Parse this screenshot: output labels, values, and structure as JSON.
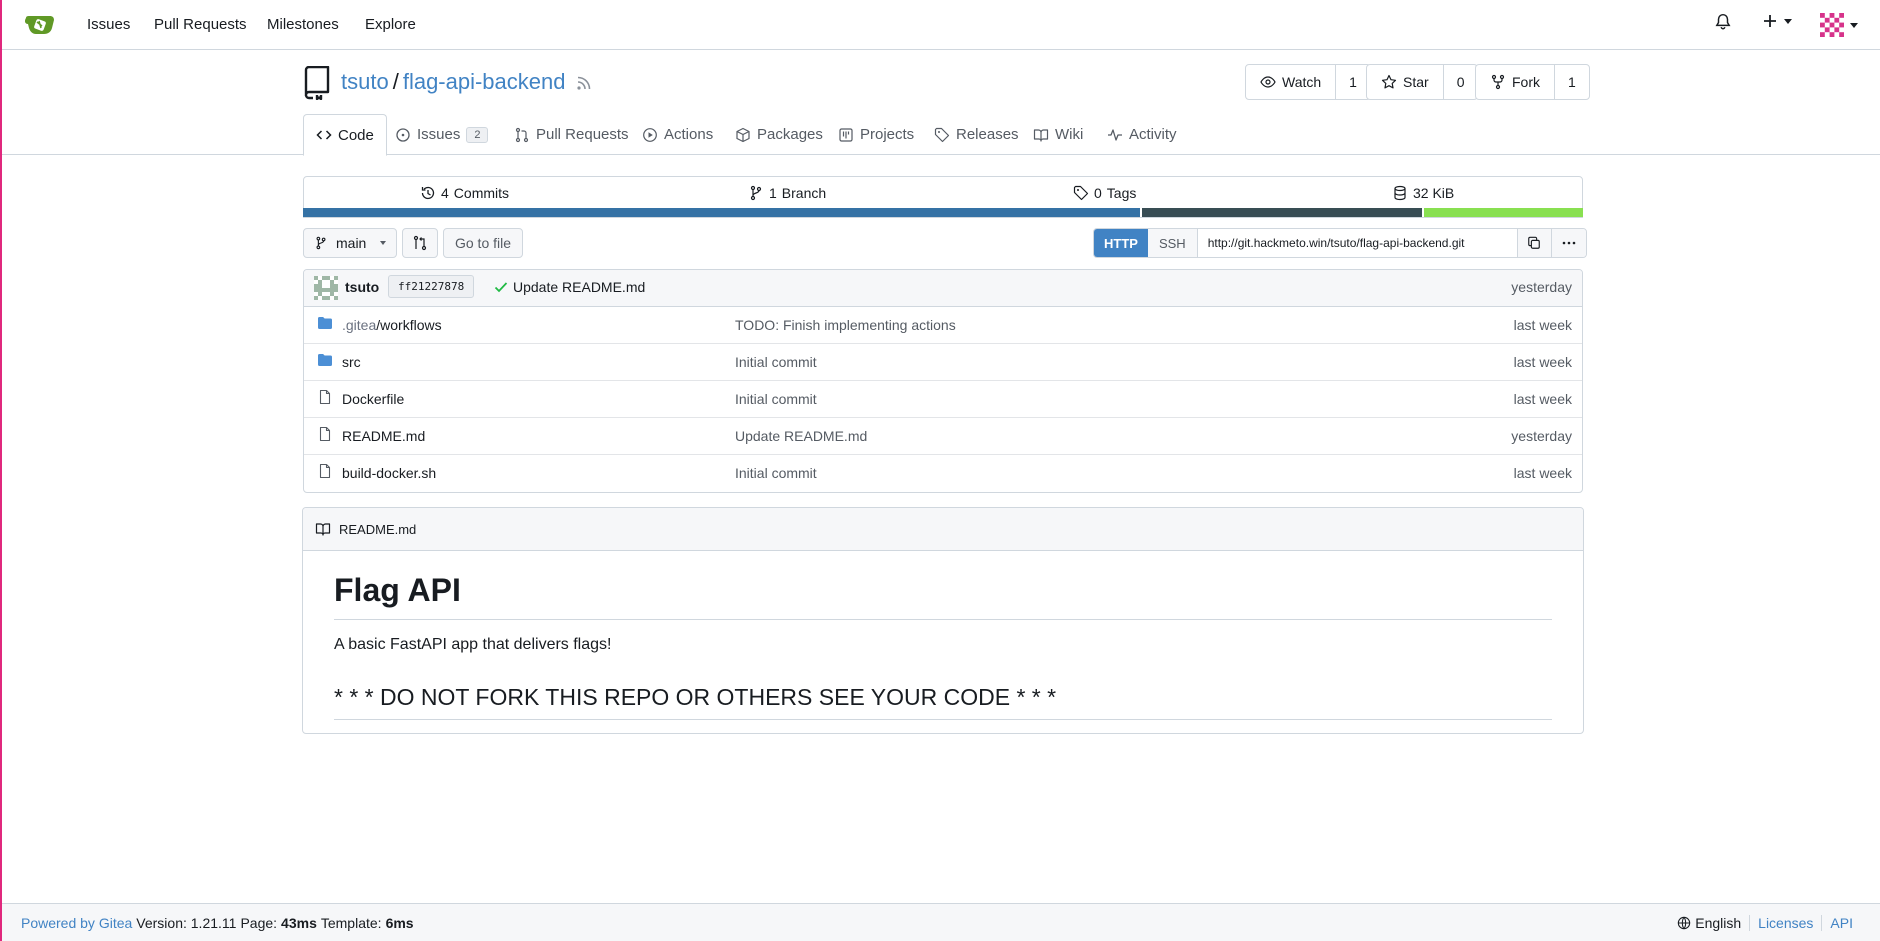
{
  "nav": {
    "items": [
      "Issues",
      "Pull Requests",
      "Milestones",
      "Explore"
    ],
    "plus_icon": "plus-icon",
    "bell_icon": "bell-icon"
  },
  "repo": {
    "owner": "tsuto",
    "name": "flag-api-backend",
    "watch_label": "Watch",
    "watch_count": "1",
    "star_label": "Star",
    "star_count": "0",
    "fork_label": "Fork",
    "fork_count": "1"
  },
  "tabs": [
    {
      "label": "Code"
    },
    {
      "label": "Issues",
      "badge": "2"
    },
    {
      "label": "Pull Requests"
    },
    {
      "label": "Actions"
    },
    {
      "label": "Packages"
    },
    {
      "label": "Projects"
    },
    {
      "label": "Releases"
    },
    {
      "label": "Wiki"
    },
    {
      "label": "Activity"
    }
  ],
  "stats": {
    "commits": "4",
    "commits_label": "Commits",
    "branches": "1",
    "branches_label": "Branch",
    "tags": "0",
    "tags_label": "Tags",
    "size": "32 KiB"
  },
  "languages": [
    {
      "color": "#3572a5",
      "fraction": 0.656
    },
    {
      "color": "#384d54",
      "fraction": 0.219
    },
    {
      "color": "#89e051",
      "fraction": 0.125
    }
  ],
  "branch": {
    "current": "main",
    "go_to_file": "Go to file",
    "clone_http": "HTTP",
    "clone_ssh": "SSH",
    "clone_url": "http://git.hackmeto.win/tsuto/flag-api-backend.git"
  },
  "latest_commit": {
    "author": "tsuto",
    "sha": "ff21227878",
    "message": "Update README.md",
    "time": "yesterday"
  },
  "files": [
    {
      "prefix": ".gitea",
      "name": "/workflows",
      "type": "dir",
      "message": "TODO: Finish implementing actions",
      "time": "last week"
    },
    {
      "prefix": "",
      "name": "src",
      "type": "dir",
      "message": "Initial commit",
      "time": "last week"
    },
    {
      "prefix": "",
      "name": "Dockerfile",
      "type": "file",
      "message": "Initial commit",
      "time": "last week"
    },
    {
      "prefix": "",
      "name": "README.md",
      "type": "file",
      "message": "Update README.md",
      "time": "yesterday"
    },
    {
      "prefix": "",
      "name": "build-docker.sh",
      "type": "file",
      "message": "Initial commit",
      "time": "last week"
    }
  ],
  "readme": {
    "filename": "README.md",
    "h1": "Flag API",
    "p1": "A basic FastAPI app that delivers flags!",
    "h2": "* * * DO NOT FORK THIS REPO OR OTHERS SEE YOUR CODE * * *"
  },
  "footer": {
    "powered": "Powered by Gitea",
    "version": "Version: 1.21.11",
    "page_label": "Page:",
    "page_time": "43ms",
    "template_label": "Template:",
    "template_time": "6ms",
    "language": "English",
    "licenses": "Licenses",
    "api": "API"
  }
}
